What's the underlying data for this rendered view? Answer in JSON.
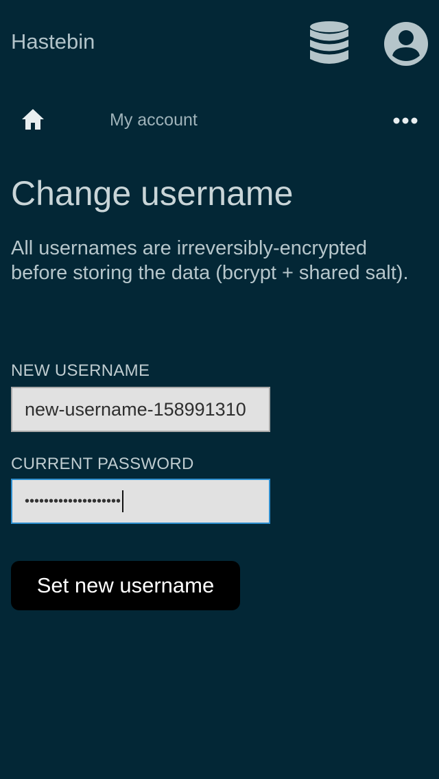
{
  "header": {
    "app_title": "Hastebin",
    "database_icon": "database-icon",
    "account_icon": "account-circle-icon"
  },
  "nav": {
    "home_icon": "home-icon",
    "my_account_label": "My account",
    "more_icon": "more-horizontal-icon"
  },
  "main": {
    "title": "Change username",
    "description": "All usernames are irreversibly-encrypted before storing the data (bcrypt + shared salt).",
    "new_username": {
      "label": "NEW USERNAME",
      "value": "new-username-158991310"
    },
    "current_password": {
      "label": "CURRENT PASSWORD",
      "masked_value": "••••••••••••••••••••"
    },
    "submit_label": "Set new username"
  },
  "colors": {
    "background": "#032736",
    "text": "#c5d2d6",
    "input_bg": "#e1e1e1",
    "focus_border": "#2e8fd0",
    "button_bg": "#000000"
  }
}
